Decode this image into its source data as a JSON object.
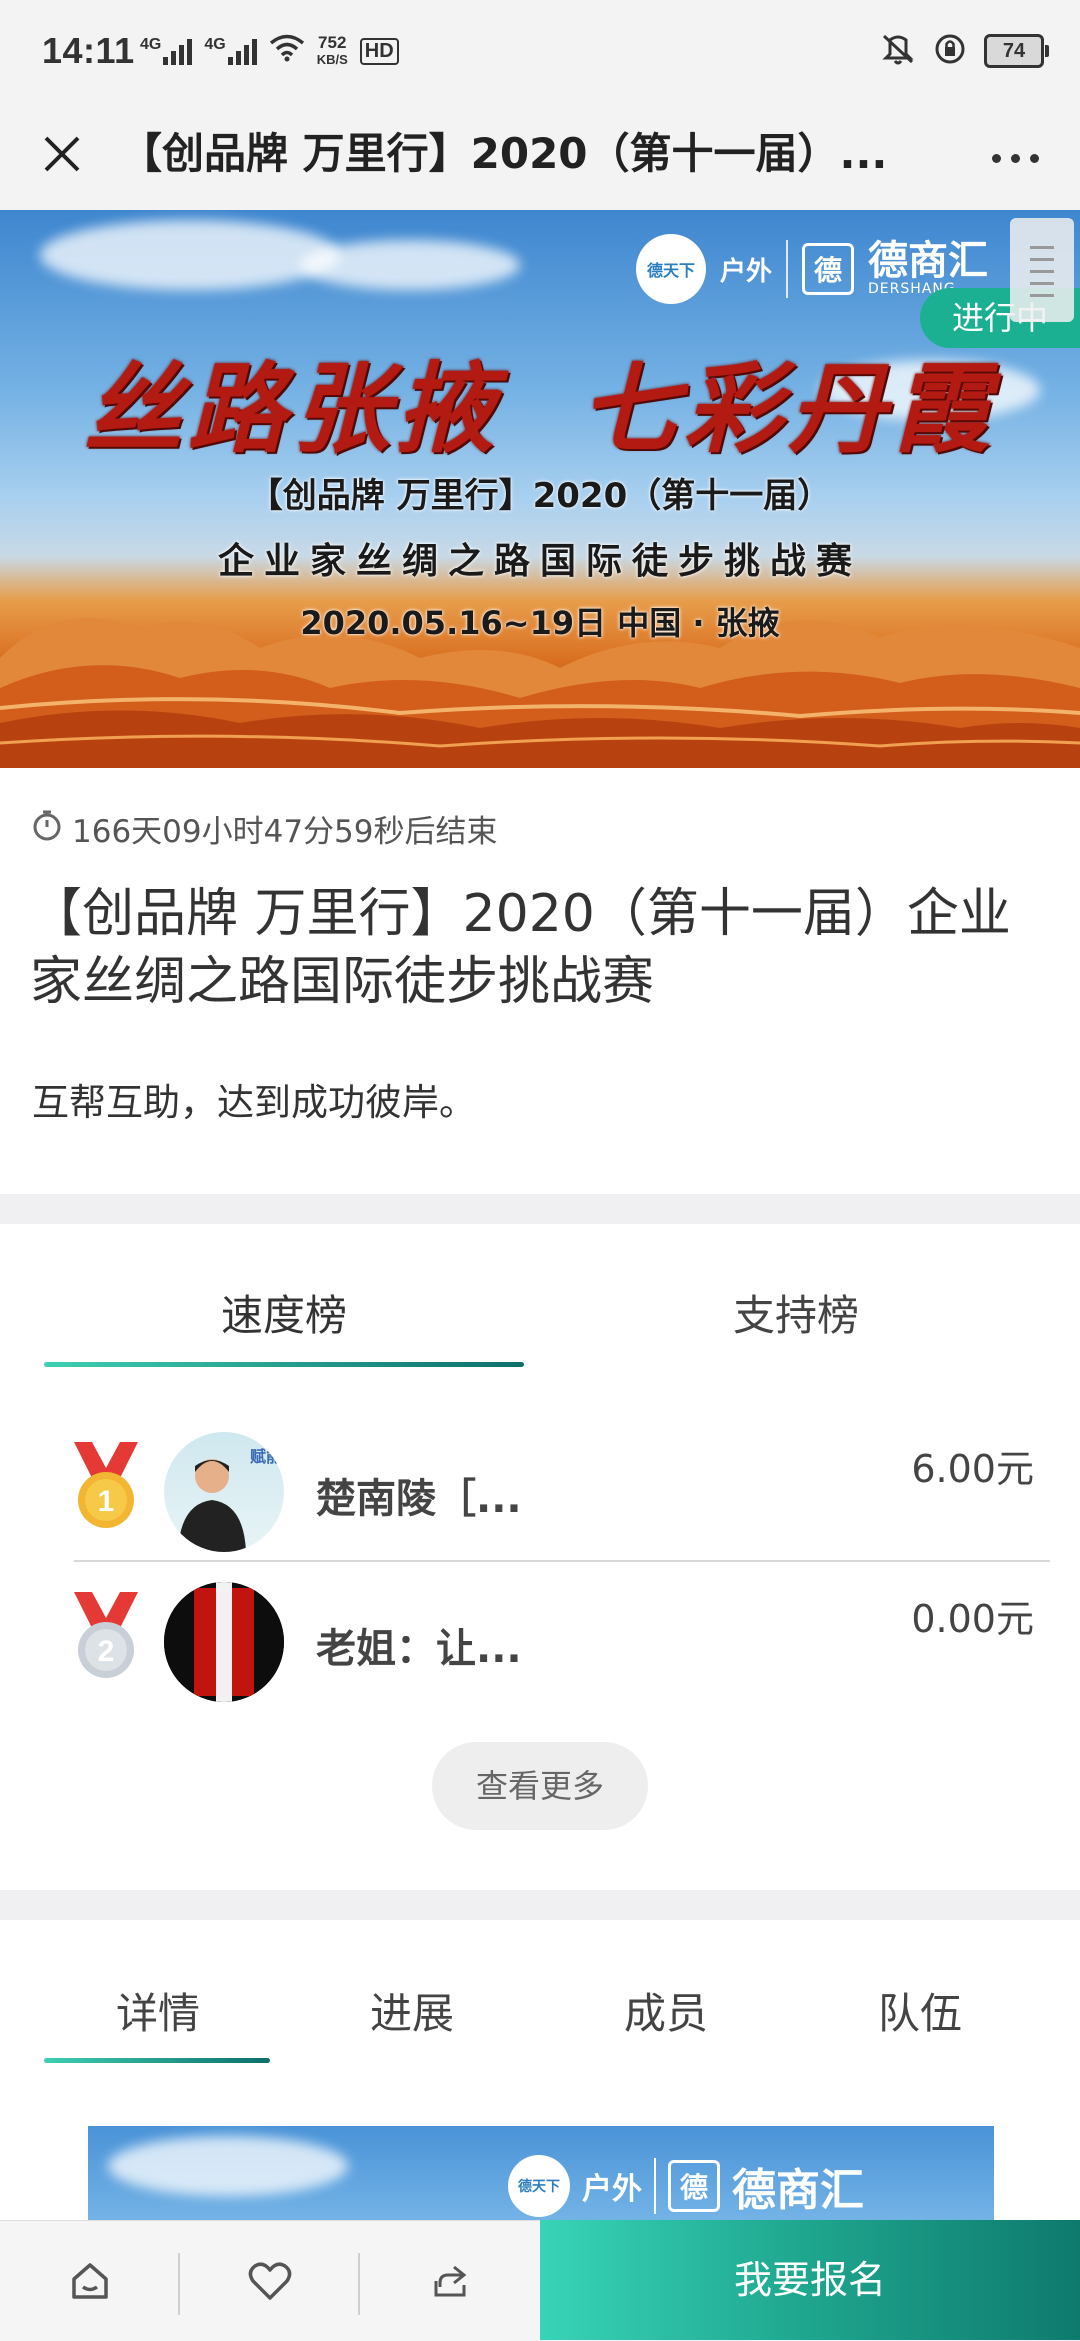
{
  "status_bar": {
    "time": "14:11",
    "network1": "4G",
    "network2": "4G",
    "speed_value": "752",
    "speed_unit": "KB/S",
    "hd_label": "HD",
    "battery": "74"
  },
  "nav": {
    "title": "【创品牌 万里行】2020（第十一届）..."
  },
  "banner": {
    "brand_seal": "德天下",
    "brand_outdoor": "户外",
    "brand_logo_char": "德",
    "brand_name": "德商汇",
    "brand_sub": "DERSHANG",
    "slogan": "丝路张掖  七彩丹霞",
    "line1": "【创品牌 万里行】2020（第十一届）",
    "line2": "企业家丝绸之路国际徒步挑战赛",
    "line3": "2020.05.16~19日  中国 · 张掖",
    "status_tag": "进行中"
  },
  "event": {
    "countdown": "166天09小时47分59秒后结束",
    "title": "【创品牌 万里行】2020（第十一届）企业家丝绸之路国际徒步挑战赛",
    "slogan": "互帮互助，达到成功彼岸。"
  },
  "ranking": {
    "tabs": [
      {
        "label": "速度榜",
        "active": true
      },
      {
        "label": "支持榜",
        "active": false
      }
    ],
    "rows": [
      {
        "rank": "1",
        "name": "楚南陵［...",
        "amount": "6.00元",
        "avatar_text": "赋能"
      },
      {
        "rank": "2",
        "name": "老姐：让...",
        "amount": "0.00元"
      }
    ],
    "more_label": "查看更多"
  },
  "detail_tabs": [
    {
      "label": "详情",
      "active": true
    },
    {
      "label": "进展",
      "active": false
    },
    {
      "label": "成员",
      "active": false
    },
    {
      "label": "队伍",
      "active": false
    }
  ],
  "bottom_bar": {
    "icons": [
      "home-icon",
      "heart-icon",
      "share-icon"
    ],
    "signup_label": "我要报名"
  },
  "colors": {
    "accent": "#1bb092",
    "gradient_start": "#38d4b8",
    "gradient_end": "#0e7a6e",
    "medal_ribbon": "#e53935",
    "gold": "#f2b632",
    "silver": "#c9cfd6"
  }
}
